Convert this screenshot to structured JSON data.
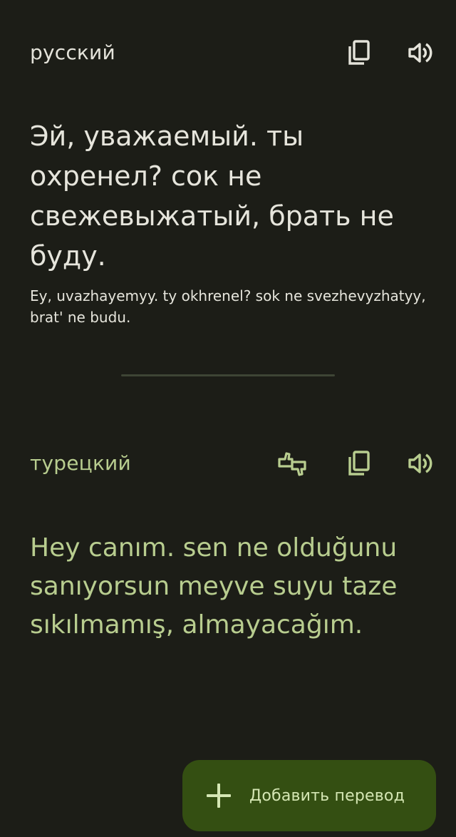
{
  "source": {
    "language": "русский",
    "text": "Эй, уважаемый. ты охренел? сок не свежевыжатый, брать не буду.",
    "transliteration": "Ey, uvazhayemyy. ty okhrenel? sok ne svezhevyzhatyy, brat' ne budu.",
    "icons": [
      "copy-icon",
      "speaker-icon"
    ]
  },
  "target": {
    "language": "турецкий",
    "text": "Hey canım.  sen ne olduğunu sanıyorsun  meyve suyu taze sıkılmamış, almayacağım.",
    "icons": [
      "feedback-icon",
      "copy-icon",
      "speaker-icon"
    ]
  },
  "fab": {
    "label": "Добавить перевод",
    "icon": "plus-icon"
  },
  "colors": {
    "background": "#1c1d17",
    "primary_text": "#e4e3da",
    "accent_text": "#b8cd8f",
    "fab_background": "#344f12",
    "fab_text": "#d5e7b4"
  }
}
